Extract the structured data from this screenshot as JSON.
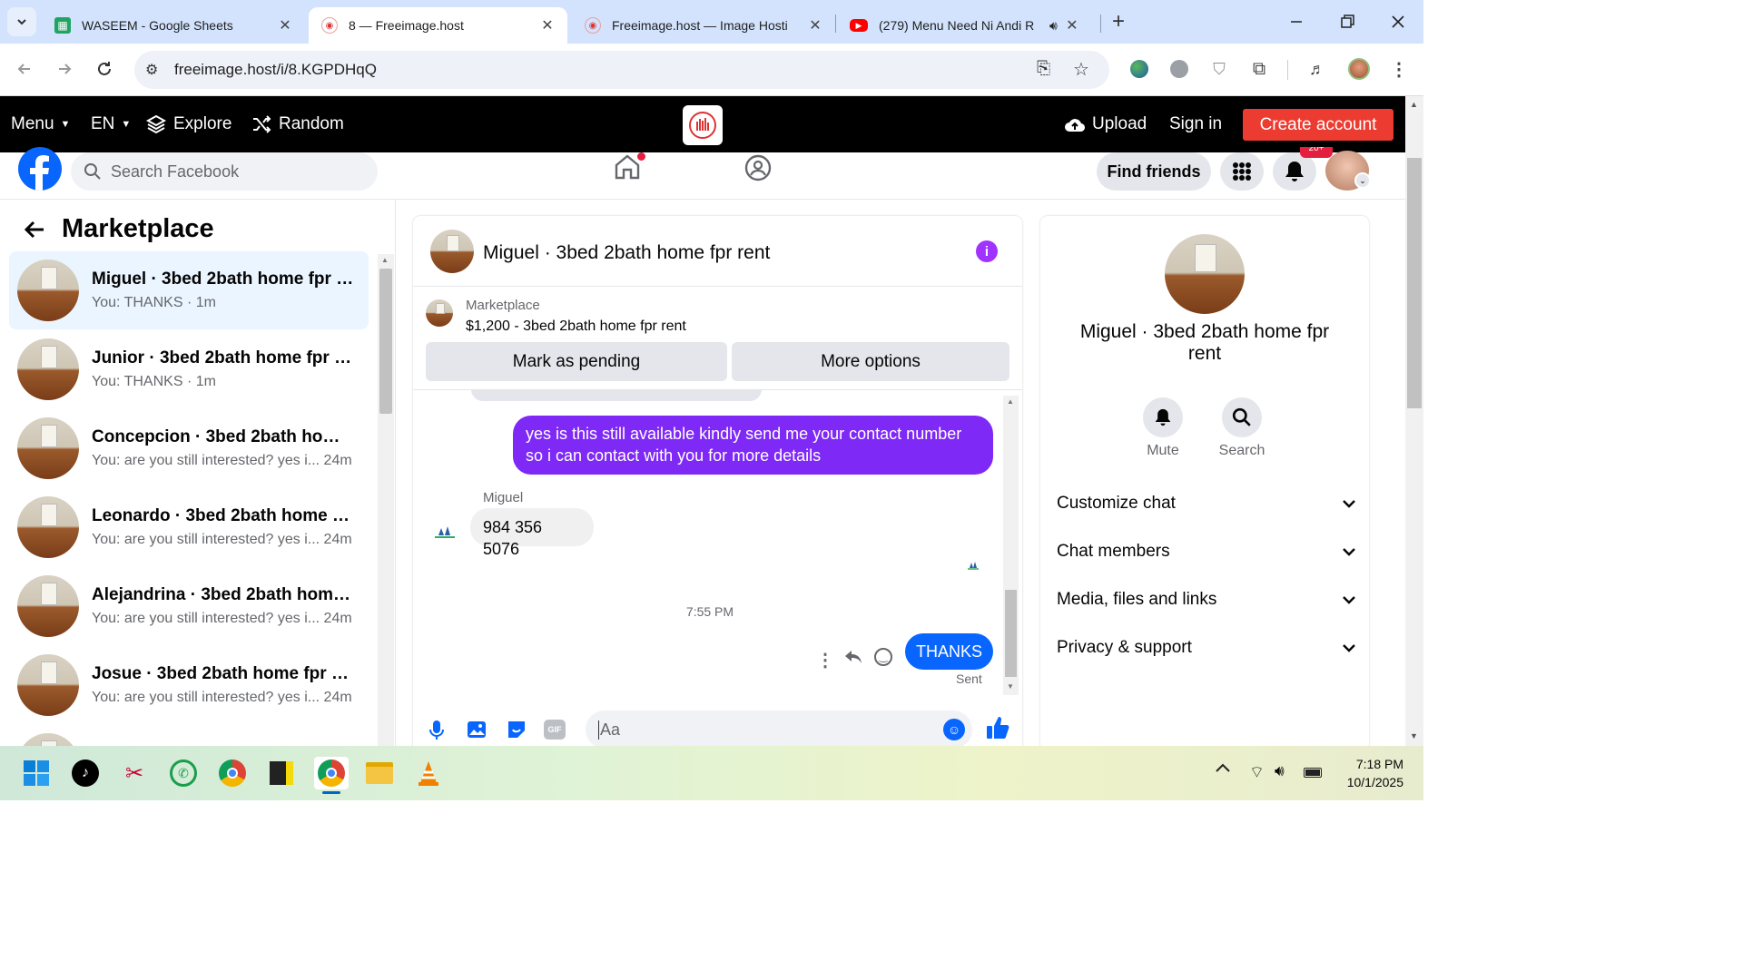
{
  "browser": {
    "tabs": [
      {
        "title": "WASEEM - Google Sheets",
        "icon": "google-sheets-icon"
      },
      {
        "title": "8 — Freeimage.host",
        "icon": "freeimage-icon"
      },
      {
        "title": "Freeimage.host — Image Hosti",
        "icon": "freeimage-icon"
      },
      {
        "title": "(279) Menu Need Ni Andi R",
        "icon": "youtube-icon"
      }
    ],
    "url": "freeimage.host/i/8.KGPDHqQ"
  },
  "freeimage": {
    "menu": "Menu",
    "lang": "EN",
    "explore": "Explore",
    "random": "Random",
    "upload": "Upload",
    "signin": "Sign in",
    "create": "Create account"
  },
  "facebook": {
    "search_placeholder": "Search Facebook",
    "find_friends": "Find friends",
    "notif_badge": "20+"
  },
  "marketplace": {
    "title": "Marketplace",
    "conversations": [
      {
        "name": "Miguel · 3bed 2bath home fpr r...",
        "sub": "You: THANKS · 1m"
      },
      {
        "name": "Junior · 3bed 2bath home fpr rent",
        "sub": "You: THANKS · 1m"
      },
      {
        "name": "Concepcion · 3bed 2bath home ...",
        "sub": "You: are you still interested? yes i...  24m"
      },
      {
        "name": "Leonardo · 3bed 2bath home fp...",
        "sub": "You: are you still interested? yes i...  24m"
      },
      {
        "name": "Alejandrina · 3bed 2bath home ...",
        "sub": "You: are you still interested? yes i...  24m"
      },
      {
        "name": "Josue · 3bed 2bath home fpr rent",
        "sub": "You: are you still interested? yes i...  24m"
      }
    ]
  },
  "chat": {
    "title": "Miguel · 3bed 2bath home fpr rent",
    "listing_label": "Marketplace",
    "listing_title": "$1,200 - 3bed 2bath home fpr rent",
    "mark_pending": "Mark as pending",
    "more_options": "More options",
    "outgoing_msg": "yes is this still available kindly send me your contact number so i can contact with you for more details",
    "sender_name": "Miguel",
    "incoming_msg": "984 356 5076",
    "timestamp": "7:55 PM",
    "thanks_msg": "THANKS",
    "sent_status": "Sent",
    "input_placeholder": "Aa",
    "colors": {
      "accent": "#a033ff",
      "outgoing": "#7e29f5",
      "blue": "#0866ff"
    }
  },
  "info_panel": {
    "name": "Miguel · 3bed 2bath home fpr rent",
    "mute": "Mute",
    "search": "Search",
    "sections": [
      "Customize chat",
      "Chat members",
      "Media, files and links",
      "Privacy & support"
    ]
  },
  "taskbar": {
    "time": "7:18 PM",
    "date": "10/1/2025"
  }
}
